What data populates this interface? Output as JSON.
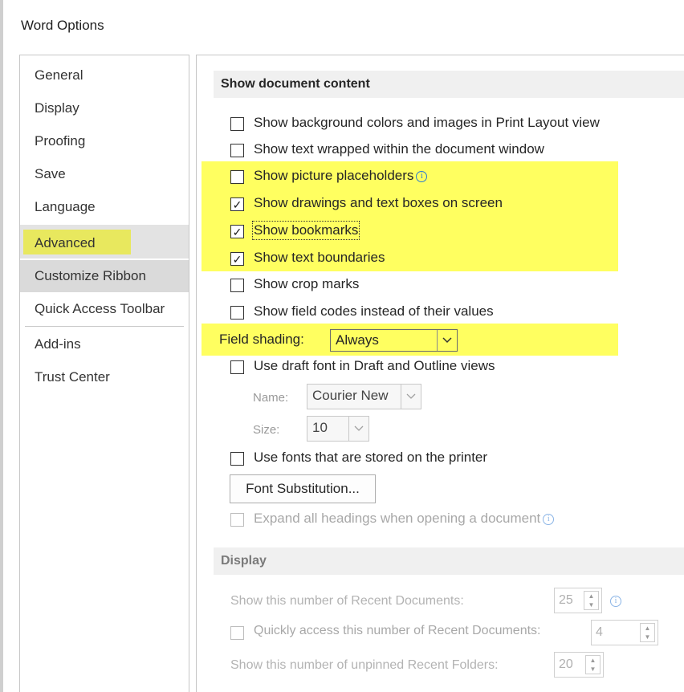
{
  "window": {
    "title": "Word Options"
  },
  "sidebar": {
    "items": [
      {
        "label": "General"
      },
      {
        "label": "Display"
      },
      {
        "label": "Proofing"
      },
      {
        "label": "Save"
      },
      {
        "label": "Language"
      },
      {
        "label": "Advanced"
      },
      {
        "label": "Customize Ribbon"
      },
      {
        "label": "Quick Access Toolbar"
      },
      {
        "label": "Add-ins"
      },
      {
        "label": "Trust Center"
      }
    ],
    "selected": "Advanced"
  },
  "show_document_content": {
    "header": "Show document content",
    "options": [
      {
        "label": "Show background colors and images in Print Layout view",
        "checked": false
      },
      {
        "label": "Show text wrapped within the document window",
        "checked": false
      },
      {
        "label": "Show picture placeholders",
        "checked": false,
        "info": true
      },
      {
        "label": "Show drawings and text boxes on screen",
        "checked": true
      },
      {
        "label": "Show bookmarks",
        "checked": true
      },
      {
        "label": "Show text boundaries",
        "checked": true
      },
      {
        "label": "Show crop marks",
        "checked": false
      },
      {
        "label": "Show field codes instead of their values",
        "checked": false
      }
    ],
    "field_shading": {
      "label": "Field shading:",
      "value": "Always"
    },
    "draft_font": {
      "label": "Use draft font in Draft and Outline views",
      "checked": false
    },
    "name": {
      "label": "Name:",
      "value": "Courier New"
    },
    "size": {
      "label": "Size:",
      "value": "10"
    },
    "printer_fonts": {
      "label": "Use fonts that are stored on the printer",
      "checked": false
    },
    "font_substitution_button": "Font Substitution...",
    "expand_headings": {
      "label": "Expand all headings when opening a document",
      "checked": false
    }
  },
  "display": {
    "header": "Display",
    "recent_docs": {
      "label": "Show this number of Recent Documents:",
      "value": "25"
    },
    "quick_access": {
      "label": "Quickly access this number of Recent Documents:",
      "value": "4"
    },
    "recent_folders": {
      "label": "Show this number of unpinned Recent Folders:",
      "value": "20"
    }
  },
  "colors": {
    "highlight": "#ffff60",
    "selected_nav": "#e3e3e3"
  },
  "icons": {
    "checkmark": "✓",
    "info": "i",
    "chevron": "chevron-down-icon"
  }
}
